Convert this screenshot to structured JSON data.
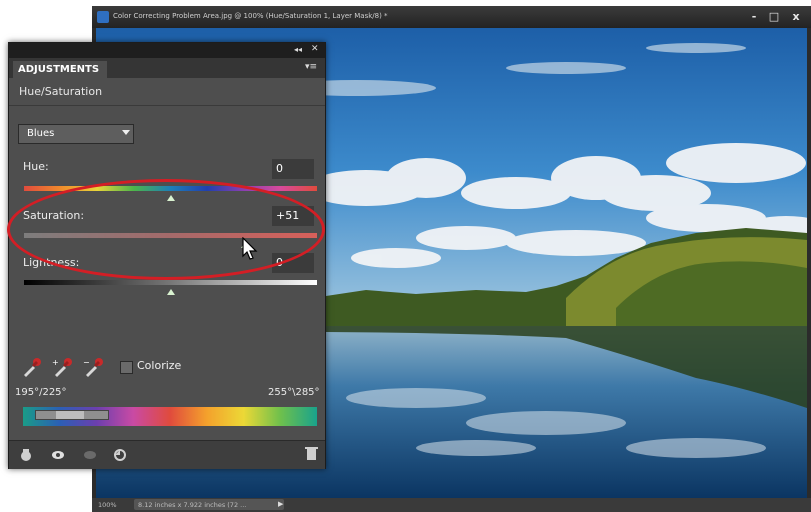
{
  "document": {
    "title": "Color Correcting Problem Area.jpg @ 100% (Hue/Saturation 1, Layer Mask/8) *",
    "zoom": "100%",
    "info": "8.12 inches x 7.922 inches (72 ...",
    "window_buttons": [
      "-",
      "□",
      "x"
    ]
  },
  "panel": {
    "tab_label": "ADJUSTMENTS",
    "collapse_label": "◂◂",
    "close_label": "✕",
    "menu_label": "▾≡",
    "adjustment_title": "Hue/Saturation",
    "channel": "Blues",
    "sliders": {
      "hue": {
        "label": "Hue:",
        "value": "0",
        "level": 0.5
      },
      "saturation": {
        "label": "Saturation:",
        "value": "+51",
        "level": 0.755
      },
      "lightness": {
        "label": "Lightness:",
        "value": "0",
        "level": 0.5
      }
    },
    "colorize_label": "Colorize",
    "colorize_checked": false,
    "range_left": "195°/225°",
    "range_right": "255°\\285°",
    "icons": [
      "eyedropper-icon",
      "eyedropper-plus-icon",
      "eyedropper-minus-icon",
      "clip-to-layer-icon",
      "visibility-eye-icon",
      "reset-icon",
      "previous-state-icon",
      "trash-icon"
    ]
  },
  "colors": {
    "annotation": "#d41e25",
    "panel_bg": "#4e4e4e",
    "sky": "#2b73b8",
    "water": "#0e3d6b"
  }
}
